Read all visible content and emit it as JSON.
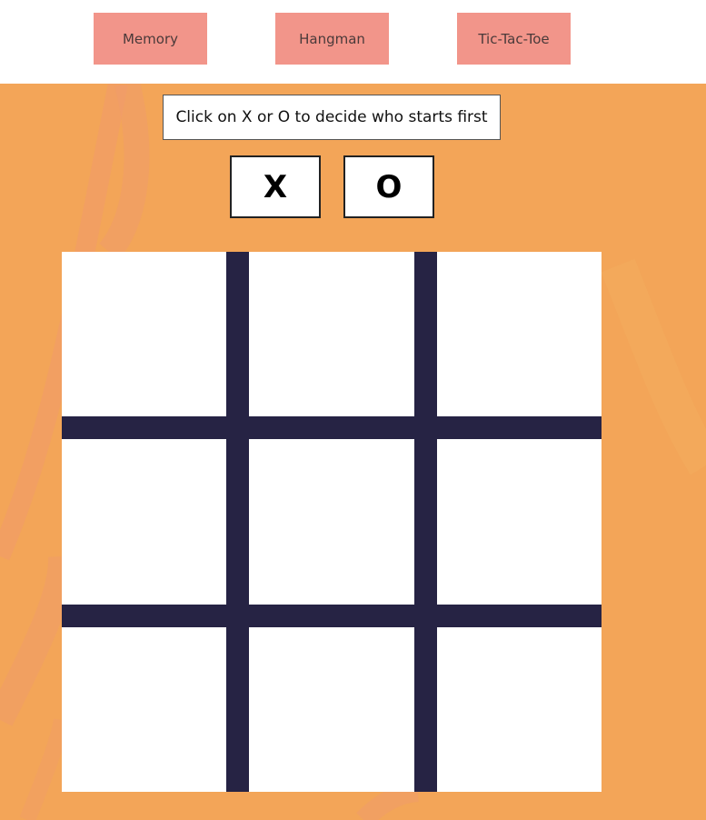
{
  "nav": {
    "memory_label": "Memory",
    "hangman_label": "Hangman",
    "tictactoe_label": "Tic-Tac-Toe"
  },
  "game": {
    "instruction": "Click on X or O to decide who starts first",
    "x_label": "X",
    "o_label": "O",
    "board": [
      "",
      "",
      "",
      "",
      "",
      "",
      "",
      "",
      ""
    ]
  },
  "colors": {
    "nav_button": "#f2958a",
    "background": "#f3a558",
    "grid_lines": "#262344",
    "cell": "#ffffff"
  }
}
